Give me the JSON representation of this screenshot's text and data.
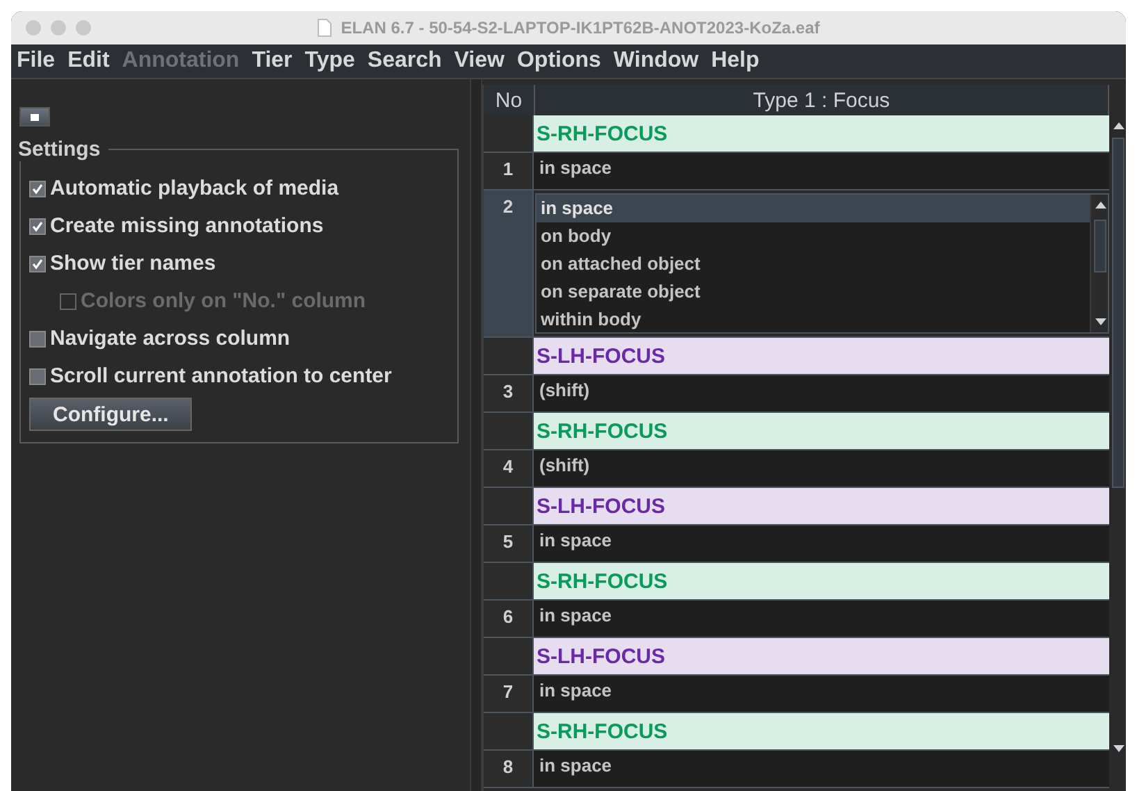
{
  "window": {
    "title": "ELAN 6.7 - 50-54-S2-LAPTOP-IK1PT62B-ANOT2023-KoZa.eaf"
  },
  "menu": [
    {
      "label": "File",
      "disabled": false
    },
    {
      "label": "Edit",
      "disabled": false
    },
    {
      "label": "Annotation",
      "disabled": true
    },
    {
      "label": "Tier",
      "disabled": false
    },
    {
      "label": "Type",
      "disabled": false
    },
    {
      "label": "Search",
      "disabled": false
    },
    {
      "label": "View",
      "disabled": false
    },
    {
      "label": "Options",
      "disabled": false
    },
    {
      "label": "Window",
      "disabled": false
    },
    {
      "label": "Help",
      "disabled": false
    }
  ],
  "settings": {
    "title": "Settings",
    "options": [
      {
        "label": "Automatic playback of media",
        "checked": true,
        "disabled": false
      },
      {
        "label": "Create missing annotations",
        "checked": true,
        "disabled": false
      },
      {
        "label": "Show tier names",
        "checked": true,
        "disabled": false,
        "children": [
          {
            "label": "Colors only on \"No.\" column",
            "checked": false,
            "disabled": true
          }
        ]
      },
      {
        "label": "Navigate across column",
        "checked": false,
        "disabled": false
      },
      {
        "label": "Scroll current annotation to center",
        "checked": false,
        "disabled": false
      }
    ],
    "button": "Configure..."
  },
  "table": {
    "columns": [
      "No",
      "Type 1 : Focus"
    ],
    "rows": [
      {
        "kind": "tier",
        "name": "S-RH-FOCUS",
        "color": "#0a9a5a"
      },
      {
        "kind": "annotation",
        "no": "1",
        "value": "in space",
        "selected": false
      },
      {
        "kind": "choice",
        "no": "2",
        "selected": true,
        "options": [
          {
            "label": "in space",
            "selected": true
          },
          {
            "label": "on body",
            "selected": false
          },
          {
            "label": "on attached object",
            "selected": false
          },
          {
            "label": "on separate object",
            "selected": false
          },
          {
            "label": "within body",
            "selected": false
          }
        ]
      },
      {
        "kind": "tier",
        "name": "S-LH-FOCUS",
        "color": "#6a2aa8"
      },
      {
        "kind": "annotation",
        "no": "3",
        "value": "(shift)",
        "selected": false
      },
      {
        "kind": "tier",
        "name": "S-RH-FOCUS",
        "color": "#0a9a5a"
      },
      {
        "kind": "annotation",
        "no": "4",
        "value": "(shift)",
        "selected": false
      },
      {
        "kind": "tier",
        "name": "S-LH-FOCUS",
        "color": "#6a2aa8"
      },
      {
        "kind": "annotation",
        "no": "5",
        "value": "in space",
        "selected": false
      },
      {
        "kind": "tier",
        "name": "S-RH-FOCUS",
        "color": "#0a9a5a"
      },
      {
        "kind": "annotation",
        "no": "6",
        "value": "in space",
        "selected": false
      },
      {
        "kind": "tier",
        "name": "S-LH-FOCUS",
        "color": "#6a2aa8"
      },
      {
        "kind": "annotation",
        "no": "7",
        "value": "in space",
        "selected": false
      },
      {
        "kind": "tier",
        "name": "S-RH-FOCUS",
        "color": "#0a9a5a"
      },
      {
        "kind": "annotation",
        "no": "8",
        "value": "in space",
        "selected": false
      }
    ]
  }
}
